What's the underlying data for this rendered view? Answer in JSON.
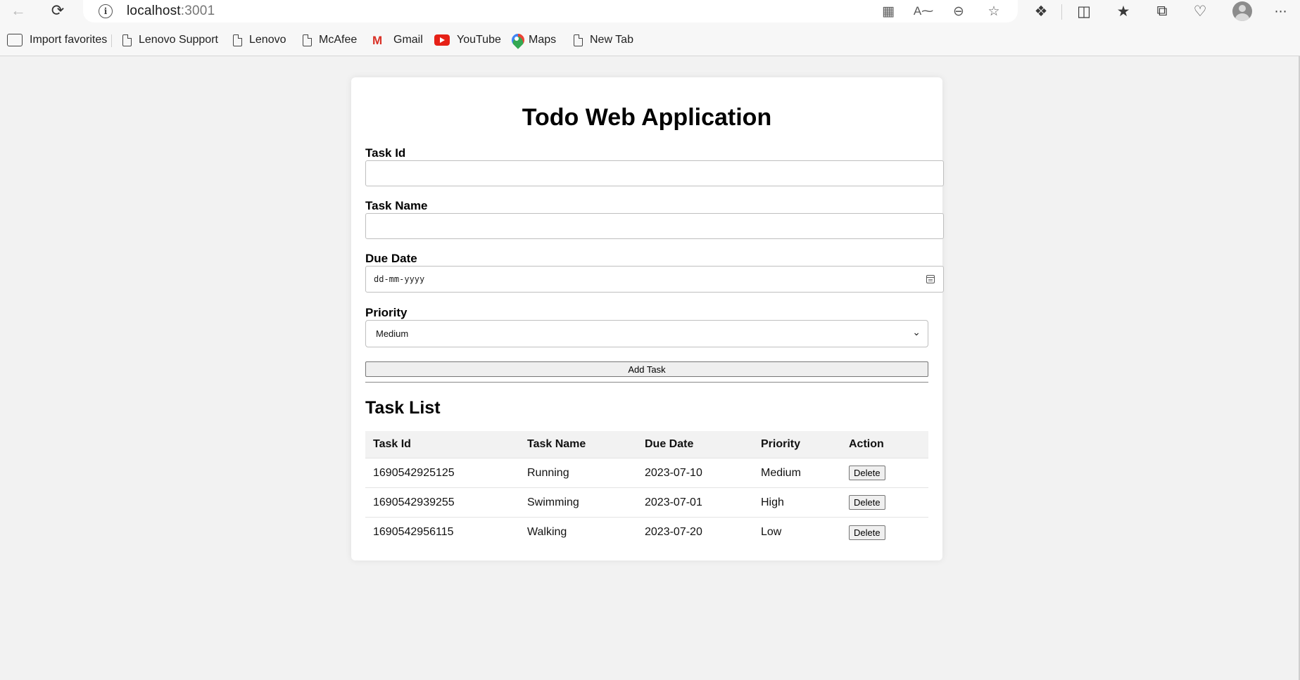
{
  "browser": {
    "url_host": "localhost",
    "url_port": ":3001",
    "bookmarks": [
      {
        "label": "Import favorites",
        "icon": "import-favorites-icon"
      },
      {
        "label": "Lenovo Support",
        "icon": "page-icon"
      },
      {
        "label": "Lenovo",
        "icon": "page-icon"
      },
      {
        "label": "McAfee",
        "icon": "page-icon"
      },
      {
        "label": "Gmail",
        "icon": "gmail-icon"
      },
      {
        "label": "YouTube",
        "icon": "youtube-icon"
      },
      {
        "label": "Maps",
        "icon": "maps-icon"
      },
      {
        "label": "New Tab",
        "icon": "page-icon"
      }
    ]
  },
  "app": {
    "title": "Todo Web Application",
    "form": {
      "task_id_label": "Task Id",
      "task_id_value": "",
      "task_name_label": "Task Name",
      "task_name_value": "",
      "due_date_label": "Due Date",
      "due_date_placeholder": "dd-mm-yyyy",
      "priority_label": "Priority",
      "priority_selected": "Medium",
      "add_button": "Add Task"
    },
    "list": {
      "title": "Task List",
      "columns": [
        "Task Id",
        "Task Name",
        "Due Date",
        "Priority",
        "Action"
      ],
      "rows": [
        {
          "id": "1690542925125",
          "name": "Running",
          "due": "2023-07-10",
          "priority": "Medium",
          "action": "Delete"
        },
        {
          "id": "1690542939255",
          "name": "Swimming",
          "due": "2023-07-01",
          "priority": "High",
          "action": "Delete"
        },
        {
          "id": "1690542956115",
          "name": "Walking",
          "due": "2023-07-20",
          "priority": "Low",
          "action": "Delete"
        }
      ]
    }
  },
  "colors": {
    "page_background": "#f2f2f2",
    "card_background": "#ffffff",
    "table_header_background": "#f2f2f2"
  }
}
